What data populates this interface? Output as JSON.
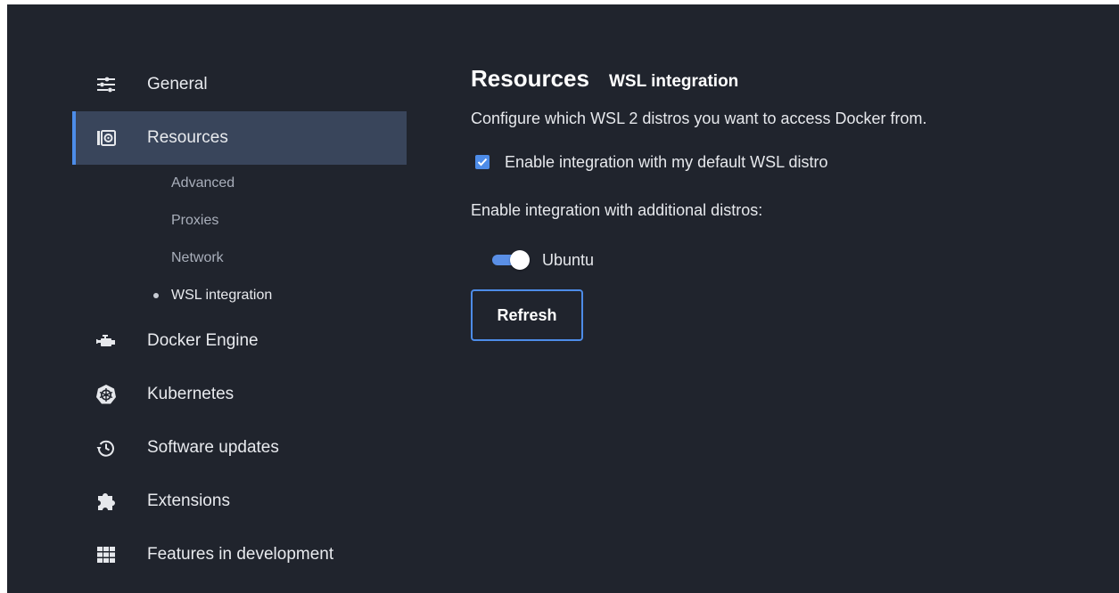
{
  "sidebar": {
    "items": [
      {
        "label": "General",
        "icon": "sliders-icon"
      },
      {
        "label": "Resources",
        "icon": "resources-icon",
        "active": true
      },
      {
        "label": "Docker Engine",
        "icon": "engine-icon"
      },
      {
        "label": "Kubernetes",
        "icon": "kubernetes-icon"
      },
      {
        "label": "Software updates",
        "icon": "history-icon"
      },
      {
        "label": "Extensions",
        "icon": "puzzle-icon"
      },
      {
        "label": "Features in development",
        "icon": "grid-icon"
      }
    ],
    "subitems": [
      {
        "label": "Advanced"
      },
      {
        "label": "Proxies"
      },
      {
        "label": "Network"
      },
      {
        "label": "WSL integration",
        "current": true
      }
    ]
  },
  "main": {
    "title": "Resources",
    "subtitle": "WSL integration",
    "description": "Configure which WSL 2 distros you want to access Docker from.",
    "default_distro_label": "Enable integration with my default WSL distro",
    "default_distro_checked": true,
    "additional_label": "Enable integration with additional distros:",
    "distros": [
      {
        "name": "Ubuntu",
        "enabled": true
      }
    ],
    "refresh_label": "Refresh"
  },
  "colors": {
    "background": "#20242d",
    "active_bg": "#39455b",
    "accent": "#4d8ce8"
  }
}
